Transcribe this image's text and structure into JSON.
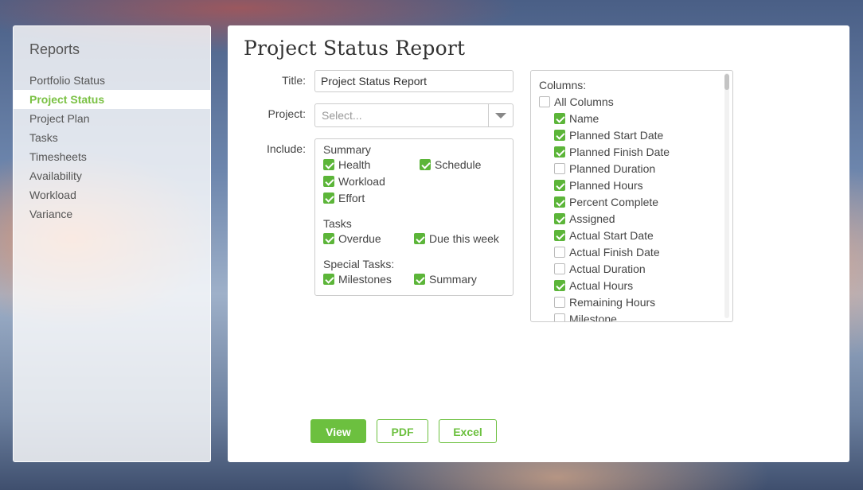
{
  "sidebar": {
    "title": "Reports",
    "items": [
      {
        "label": "Portfolio Status",
        "active": false
      },
      {
        "label": "Project Status",
        "active": true
      },
      {
        "label": "Project Plan",
        "active": false
      },
      {
        "label": "Tasks",
        "active": false
      },
      {
        "label": "Timesheets",
        "active": false
      },
      {
        "label": "Availability",
        "active": false
      },
      {
        "label": "Workload",
        "active": false
      },
      {
        "label": "Variance",
        "active": false
      }
    ]
  },
  "main": {
    "page_title": "Project Status Report",
    "title_label": "Title:",
    "title_value": "Project Status Report",
    "project_label": "Project:",
    "project_placeholder": "Select...",
    "include_label": "Include:",
    "include": {
      "summary_heading": "Summary",
      "health": {
        "label": "Health",
        "checked": true
      },
      "schedule": {
        "label": "Schedule",
        "checked": true
      },
      "workload": {
        "label": "Workload",
        "checked": true
      },
      "effort": {
        "label": "Effort",
        "checked": true
      },
      "tasks_heading": "Tasks",
      "overdue": {
        "label": "Overdue",
        "checked": true
      },
      "due_this_week": {
        "label": "Due this week",
        "checked": true
      },
      "special_heading": "Special Tasks:",
      "milestones": {
        "label": "Milestones",
        "checked": true
      },
      "summary_tasks": {
        "label": "Summary",
        "checked": true
      }
    },
    "columns": {
      "label": "Columns:",
      "all_columns": {
        "label": "All Columns",
        "checked": false
      },
      "items": [
        {
          "label": "Name",
          "checked": true
        },
        {
          "label": "Planned Start Date",
          "checked": true
        },
        {
          "label": "Planned Finish Date",
          "checked": true
        },
        {
          "label": "Planned Duration",
          "checked": false
        },
        {
          "label": "Planned Hours",
          "checked": true
        },
        {
          "label": "Percent Complete",
          "checked": true
        },
        {
          "label": "Assigned",
          "checked": true
        },
        {
          "label": "Actual Start Date",
          "checked": true
        },
        {
          "label": "Actual Finish Date",
          "checked": false
        },
        {
          "label": "Actual Duration",
          "checked": false
        },
        {
          "label": "Actual Hours",
          "checked": true
        },
        {
          "label": "Remaining Hours",
          "checked": false
        },
        {
          "label": "Milestone",
          "checked": false
        }
      ]
    },
    "buttons": {
      "view": "View",
      "pdf": "PDF",
      "excel": "Excel"
    }
  },
  "colors": {
    "accent": "#6cc03f",
    "active_nav": "#7ac143"
  }
}
